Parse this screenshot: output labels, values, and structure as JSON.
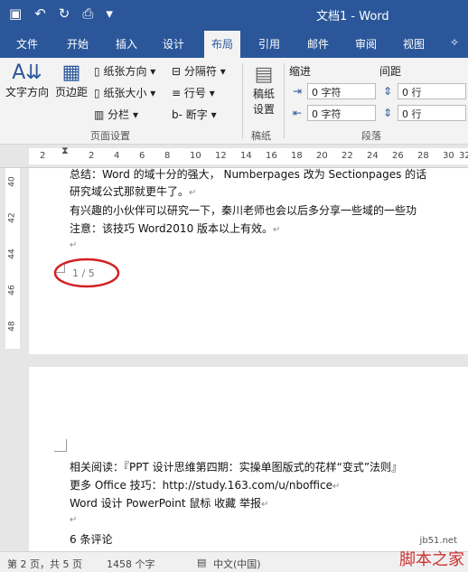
{
  "app": {
    "doc_title": "文档1 - Word"
  },
  "menu": {
    "tabs": [
      "文件",
      "开始",
      "插入",
      "设计",
      "布局",
      "引用",
      "邮件",
      "审阅",
      "视图"
    ],
    "active": "布局"
  },
  "ribbon": {
    "text_direction": "文字方向",
    "margins": "页边距",
    "orientation": "纸张方向",
    "size": "纸张大小",
    "columns": "分栏",
    "breaks": "分隔符",
    "line_numbers": "行号",
    "hyphenation": "断字",
    "group_page_setup": "页面设置",
    "draft_paper_line1": "稿纸",
    "draft_paper_line2": "设置",
    "group_draft": "稿纸",
    "indent_label": "缩进",
    "spacing_label": "间距",
    "indent_left": "0 字符",
    "indent_right": "0 字符",
    "spacing_before": "0 行",
    "spacing_after": "0 行",
    "group_paragraph": "段落"
  },
  "ruler": {
    "h": [
      "2",
      "2",
      "4",
      "6",
      "8",
      "10",
      "12",
      "14",
      "16",
      "18",
      "20",
      "22",
      "24",
      "26",
      "28",
      "30",
      "32"
    ],
    "v": [
      "40",
      "42",
      "44",
      "46",
      "48"
    ]
  },
  "page1": {
    "l1": "总结：Word 的域十分的强大，   Numberpages  改为   Sectionpages  的话",
    "l2": "研究域公式那就更牛了。",
    "l3": "有兴趣的小伙伴可以研究一下，秦川老师也会以后多分享一些域的一些功",
    "l4": "注意：该技巧 Word2010 版本以上有效。",
    "footer_num": "1 / 5"
  },
  "page2": {
    "l1": "相关阅读：『PPT 设计思维第四期：实操单图版式的花样“变式”法则』",
    "l2": "更多 Office 技巧：http://study.163.com/u/nboffice",
    "l3": " Word  设计  PowerPoint  鼠标  收藏    举报",
    "l5": "6  条评论"
  },
  "status": {
    "page": "第 2 页，共 5 页",
    "words": "1458 个字",
    "lang": "中文(中国)"
  },
  "watermark": {
    "text": "脚本之家",
    "url": "jb51.net"
  }
}
